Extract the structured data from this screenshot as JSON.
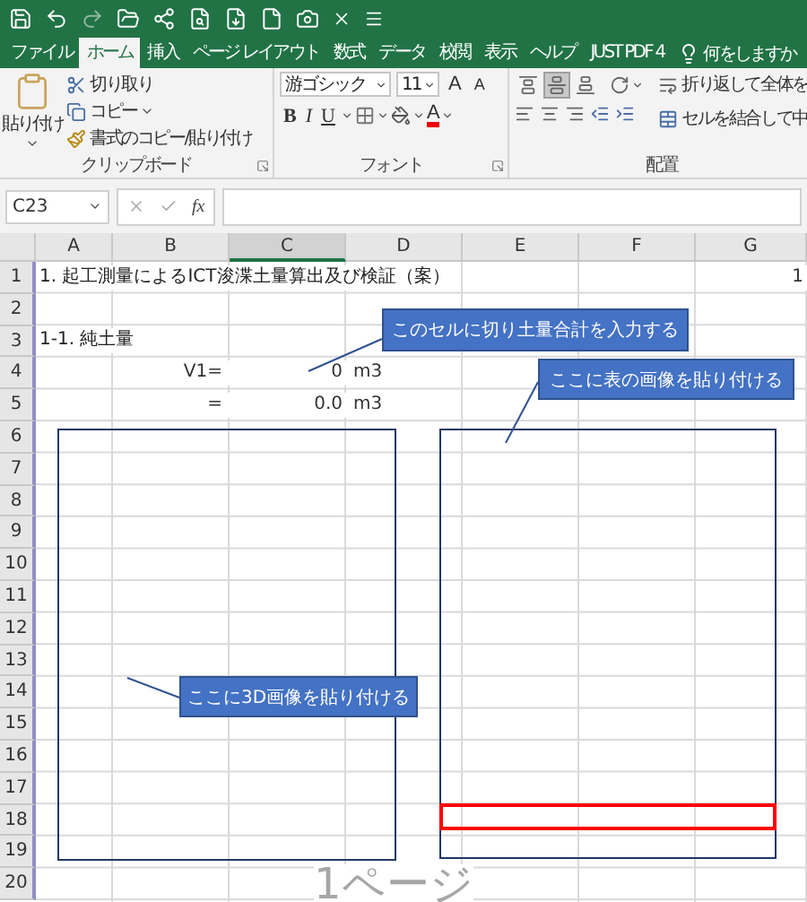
{
  "ribbon_tabs": [
    {
      "label": "ファイル",
      "selected": false
    },
    {
      "label": "ホーム",
      "selected": true
    },
    {
      "label": "挿入",
      "selected": false
    },
    {
      "label": "ページ レイアウト",
      "selected": false
    },
    {
      "label": "数式",
      "selected": false
    },
    {
      "label": "データ",
      "selected": false
    },
    {
      "label": "校閲",
      "selected": false
    },
    {
      "label": "表示",
      "selected": false
    },
    {
      "label": "ヘルプ",
      "selected": false
    },
    {
      "label": "JUST PDF 4",
      "selected": false
    }
  ],
  "tell_me": "何をしますか",
  "clipboard_group": {
    "paste": "貼り付け",
    "cut": "切り取り",
    "copy": "コピー",
    "format_painter": "書式のコピー/貼り付け",
    "label": "クリップボード"
  },
  "font_group": {
    "font_name": "游ゴシック",
    "font_size": "11",
    "grow_glyph": "A",
    "shrink_glyph": "A",
    "bold": "B",
    "italic": "I",
    "underline": "U",
    "font_color_glyph": "A",
    "label": "フォント"
  },
  "alignment_group": {
    "vertical_align": [
      {
        "selected": false
      },
      {
        "selected": true
      },
      {
        "selected": false
      }
    ],
    "wrap_text": "折り返して全体を",
    "merge": "セルを結合して中",
    "label": "配置"
  },
  "name_box": "C23",
  "function_glyph": "fx",
  "columns": [
    {
      "label": "A",
      "selected": false
    },
    {
      "label": "B",
      "selected": false
    },
    {
      "label": "C",
      "selected": true
    },
    {
      "label": "D",
      "selected": false
    },
    {
      "label": "E",
      "selected": false
    },
    {
      "label": "F",
      "selected": false
    },
    {
      "label": "G",
      "selected": false
    }
  ],
  "rows": [
    {
      "header": "1",
      "cells": {
        "a": {
          "text": "1.  起工測量によるICT浚渫土量算出及び検証（案）",
          "kind": "heading"
        },
        "g": {
          "text": "1",
          "kind": "number"
        }
      }
    },
    {
      "header": "2"
    },
    {
      "header": "3",
      "cells": {
        "a": {
          "text": "1-1.  純土量",
          "kind": "heading"
        }
      }
    },
    {
      "header": "4",
      "cells": {
        "b": {
          "text": "V1=",
          "kind": "term"
        },
        "c": {
          "text": "0",
          "kind": "number"
        },
        "d": {
          "text": "m3",
          "kind": "unit"
        }
      }
    },
    {
      "header": "5",
      "cells": {
        "b": {
          "text": "=",
          "kind": "term"
        },
        "c": {
          "text": "0.0",
          "kind": "number"
        },
        "d": {
          "text": "m3",
          "kind": "unit"
        }
      }
    },
    {
      "header": "6"
    },
    {
      "header": "7"
    },
    {
      "header": "8"
    },
    {
      "header": "9"
    },
    {
      "header": "10"
    },
    {
      "header": "11"
    },
    {
      "header": "12"
    },
    {
      "header": "13"
    },
    {
      "header": "14"
    },
    {
      "header": "15"
    },
    {
      "header": "16"
    },
    {
      "header": "17"
    },
    {
      "header": "18"
    },
    {
      "header": "19"
    },
    {
      "header": "20"
    }
  ],
  "shapes": [
    {
      "kind": "frame",
      "color": "#203864"
    },
    {
      "kind": "frame",
      "color": "#203864"
    },
    {
      "kind": "frame",
      "color": "#ff0000"
    },
    {
      "kind": "callout",
      "text": "このセルに切り土量合計を入力する"
    },
    {
      "kind": "callout",
      "text": "ここに表の画像を貼り付ける"
    },
    {
      "kind": "callout",
      "text": "ここに3D画像を貼り付ける"
    }
  ],
  "page_label": "1ページ"
}
